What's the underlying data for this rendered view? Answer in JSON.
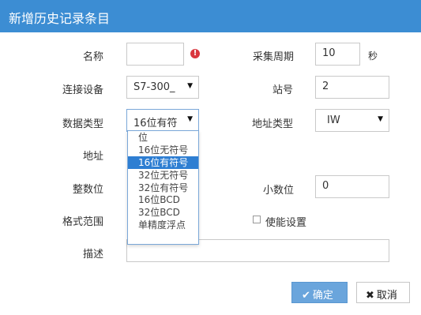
{
  "dialog": {
    "title": "新增历史记录条目"
  },
  "form": {
    "name_label": "名称",
    "name_value": "",
    "warn_glyph": "!",
    "period_label": "采集周期",
    "period_value": "10",
    "period_unit": "秒",
    "device_label": "连接设备",
    "device_value": "S7-300_",
    "station_label": "站号",
    "station_value": "2",
    "datatype_label": "数据类型",
    "datatype_value": "16位有符",
    "addrtype_label": "地址类型",
    "addrtype_value": "IW",
    "address_label": "地址",
    "intdigits_label": "整数位",
    "decimal_label": "小数位",
    "decimal_value": "0",
    "format_label": "格式范围",
    "enable_label": "使能设置",
    "enable_checked": false,
    "desc_label": "描述",
    "desc_value": ""
  },
  "datatype_options": [
    "位",
    "16位无符号",
    "16位有符号",
    "32位无符号",
    "32位有符号",
    "16位BCD",
    "32位BCD",
    "单精度浮点"
  ],
  "datatype_selected": "16位有符号",
  "buttons": {
    "ok_icon": "✔",
    "ok_label": "确定",
    "cancel_icon": "✖",
    "cancel_label": "取消"
  },
  "icons": {
    "caret": "chevron-down-icon",
    "warn": "exclamation-icon",
    "ok": "check-icon",
    "cancel": "close-icon"
  },
  "colors": {
    "titlebar": "#3c8dd3",
    "selected_option": "#2e7ed2",
    "ok_button": "#6aa5dc",
    "warning": "#d9363e"
  }
}
